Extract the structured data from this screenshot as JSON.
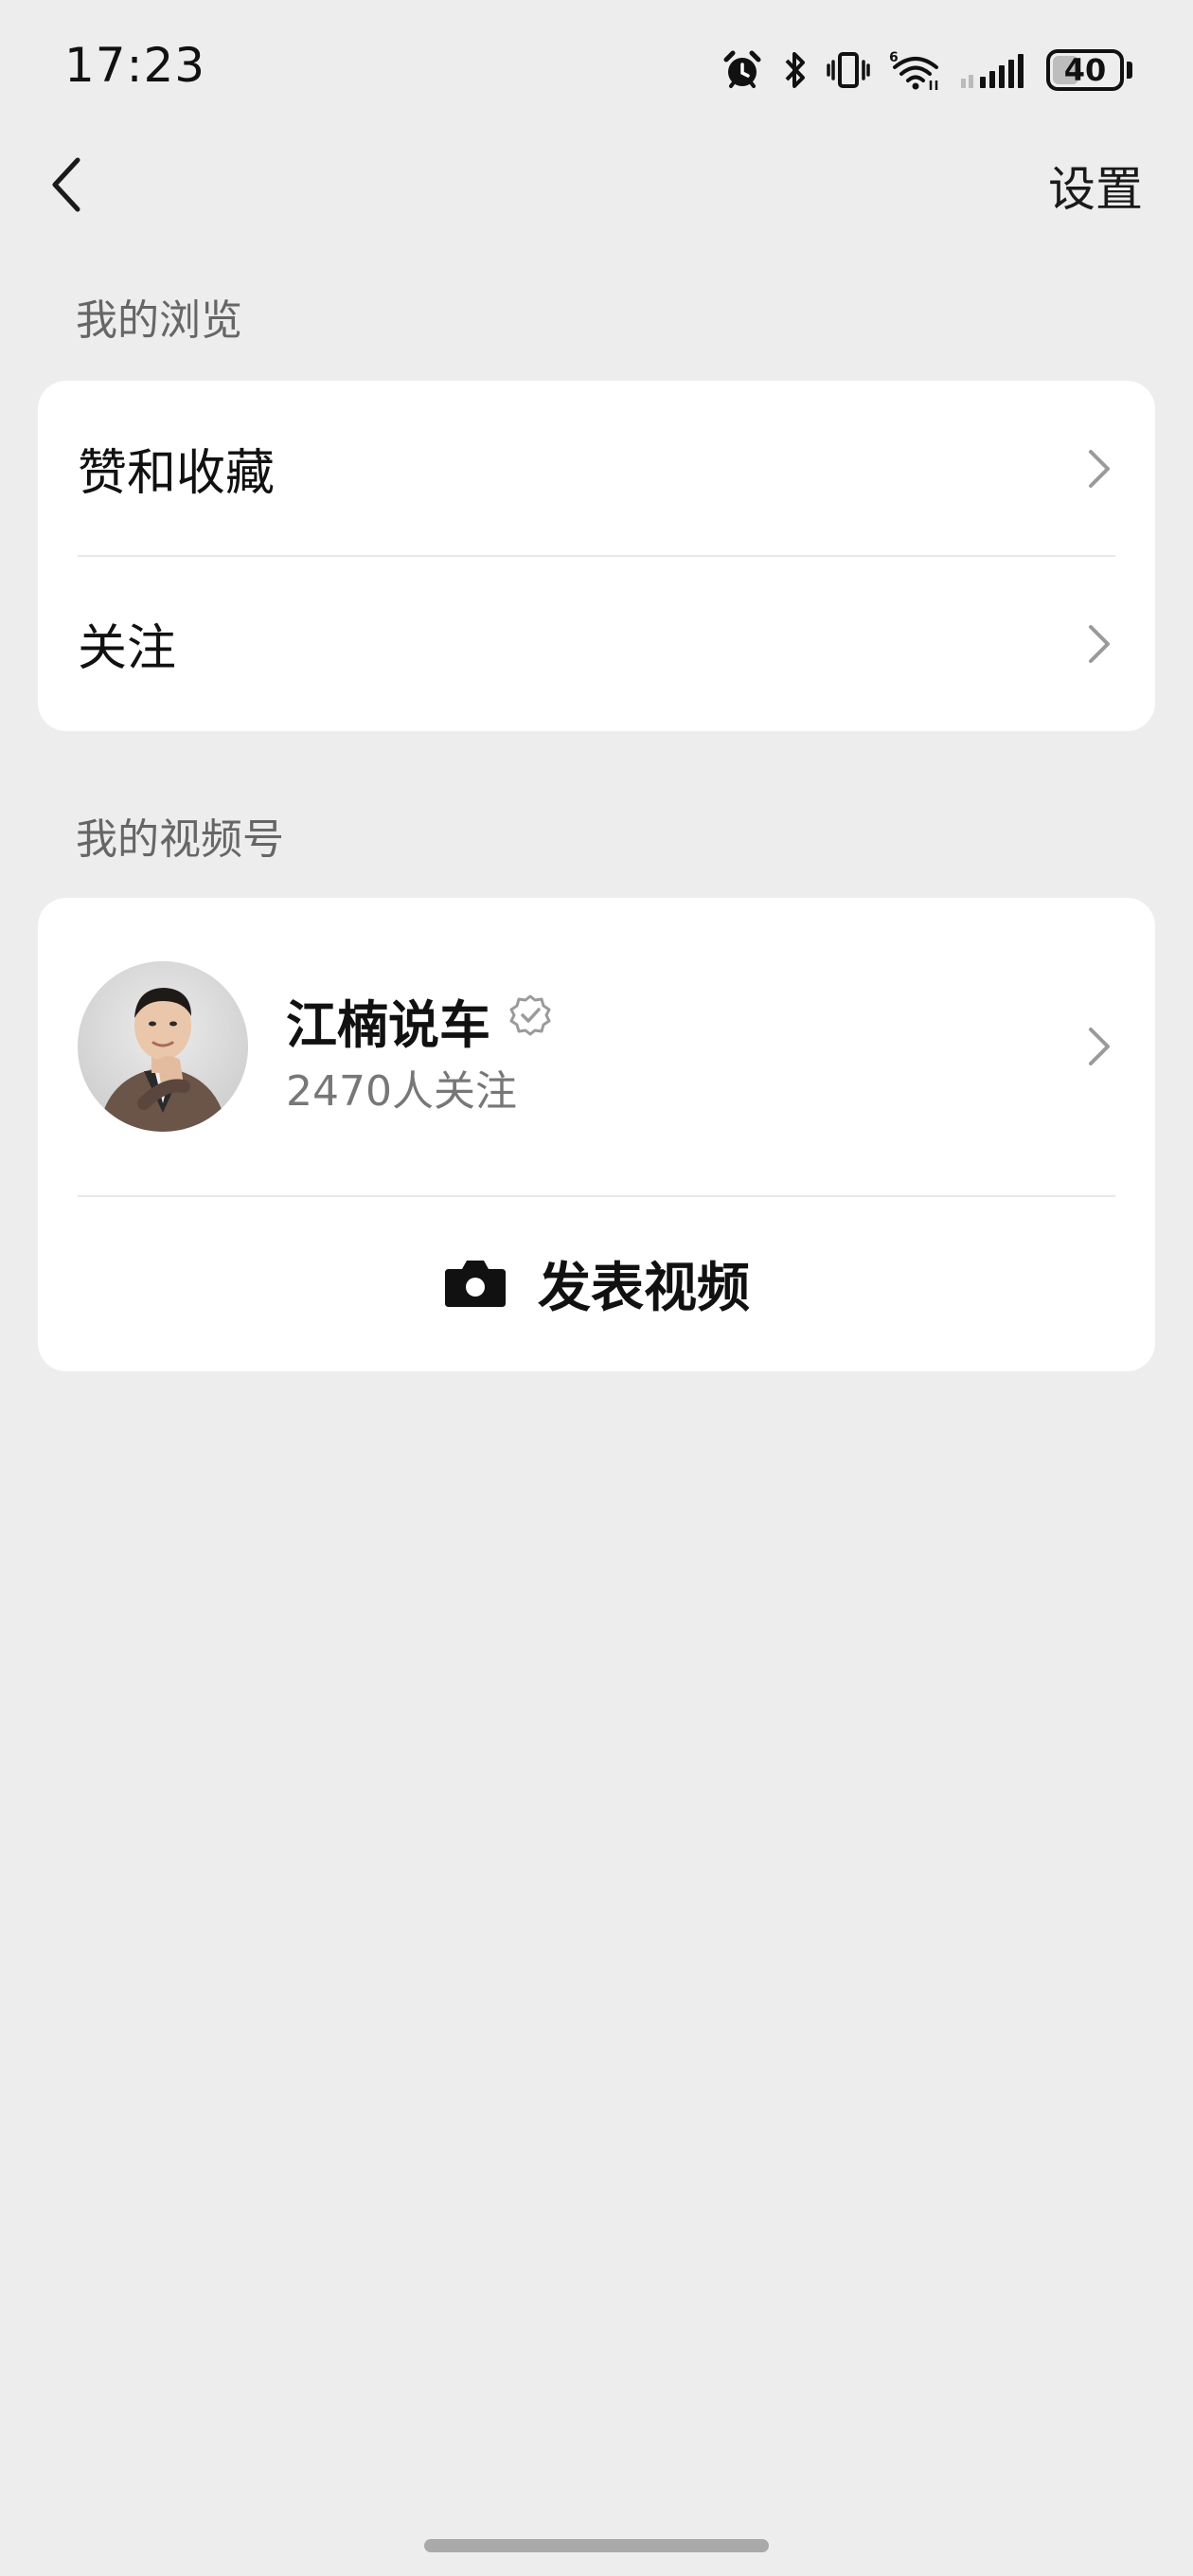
{
  "status_bar": {
    "time": "17:23",
    "battery_level": "40",
    "battery_percent": 40,
    "icons": [
      "alarm-icon",
      "bluetooth-icon",
      "vibrate-icon",
      "wifi-icon",
      "signal-icon",
      "battery-icon"
    ]
  },
  "nav": {
    "back_icon": "chevron-left-icon",
    "settings_label": "设置"
  },
  "browse": {
    "section_label": "我的浏览",
    "items": [
      {
        "label": "赞和收藏"
      },
      {
        "label": "关注"
      }
    ]
  },
  "channel": {
    "section_label": "我的视频号",
    "name": "江楠说车",
    "followers": "2470人关注",
    "verified_icon": "verified-badge-icon",
    "post_video_label": "发表视频",
    "post_video_icon": "camera-icon"
  },
  "colors": {
    "background": "#ededed",
    "card": "#ffffff",
    "text_primary": "#111111",
    "text_secondary": "#666666"
  }
}
